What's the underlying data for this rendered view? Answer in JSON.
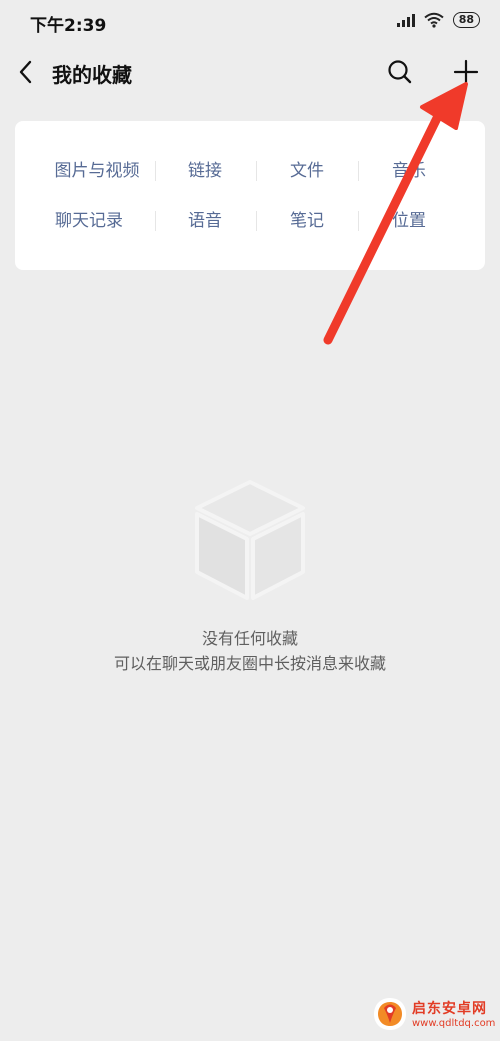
{
  "status_bar": {
    "time": "下午2:39",
    "battery": "88",
    "icons": [
      "signal-icon",
      "wifi-icon",
      "battery-icon"
    ]
  },
  "nav_bar": {
    "title": "我的收藏",
    "back_icon": "back-icon",
    "search_icon": "search-icon",
    "add_icon": "plus-icon"
  },
  "categories": {
    "row1": [
      "图片与视频",
      "链接",
      "文件",
      "音乐"
    ],
    "row2": [
      "聊天记录",
      "语音",
      "笔记",
      "位置"
    ]
  },
  "empty_state": {
    "icon": "cube-icon",
    "title": "没有任何收藏",
    "hint": "可以在聊天或朋友圈中长按消息来收藏"
  },
  "annotation": {
    "color": "#f03a2a",
    "points_to": "plus-icon"
  },
  "watermark": {
    "name": "启东安卓网",
    "url": "www.qdltdq.com",
    "color": "#e23c25"
  },
  "colors": {
    "background": "#ededed",
    "card": "#ffffff",
    "link_blue": "#576b95",
    "muted_text": "#5f5f5f"
  }
}
